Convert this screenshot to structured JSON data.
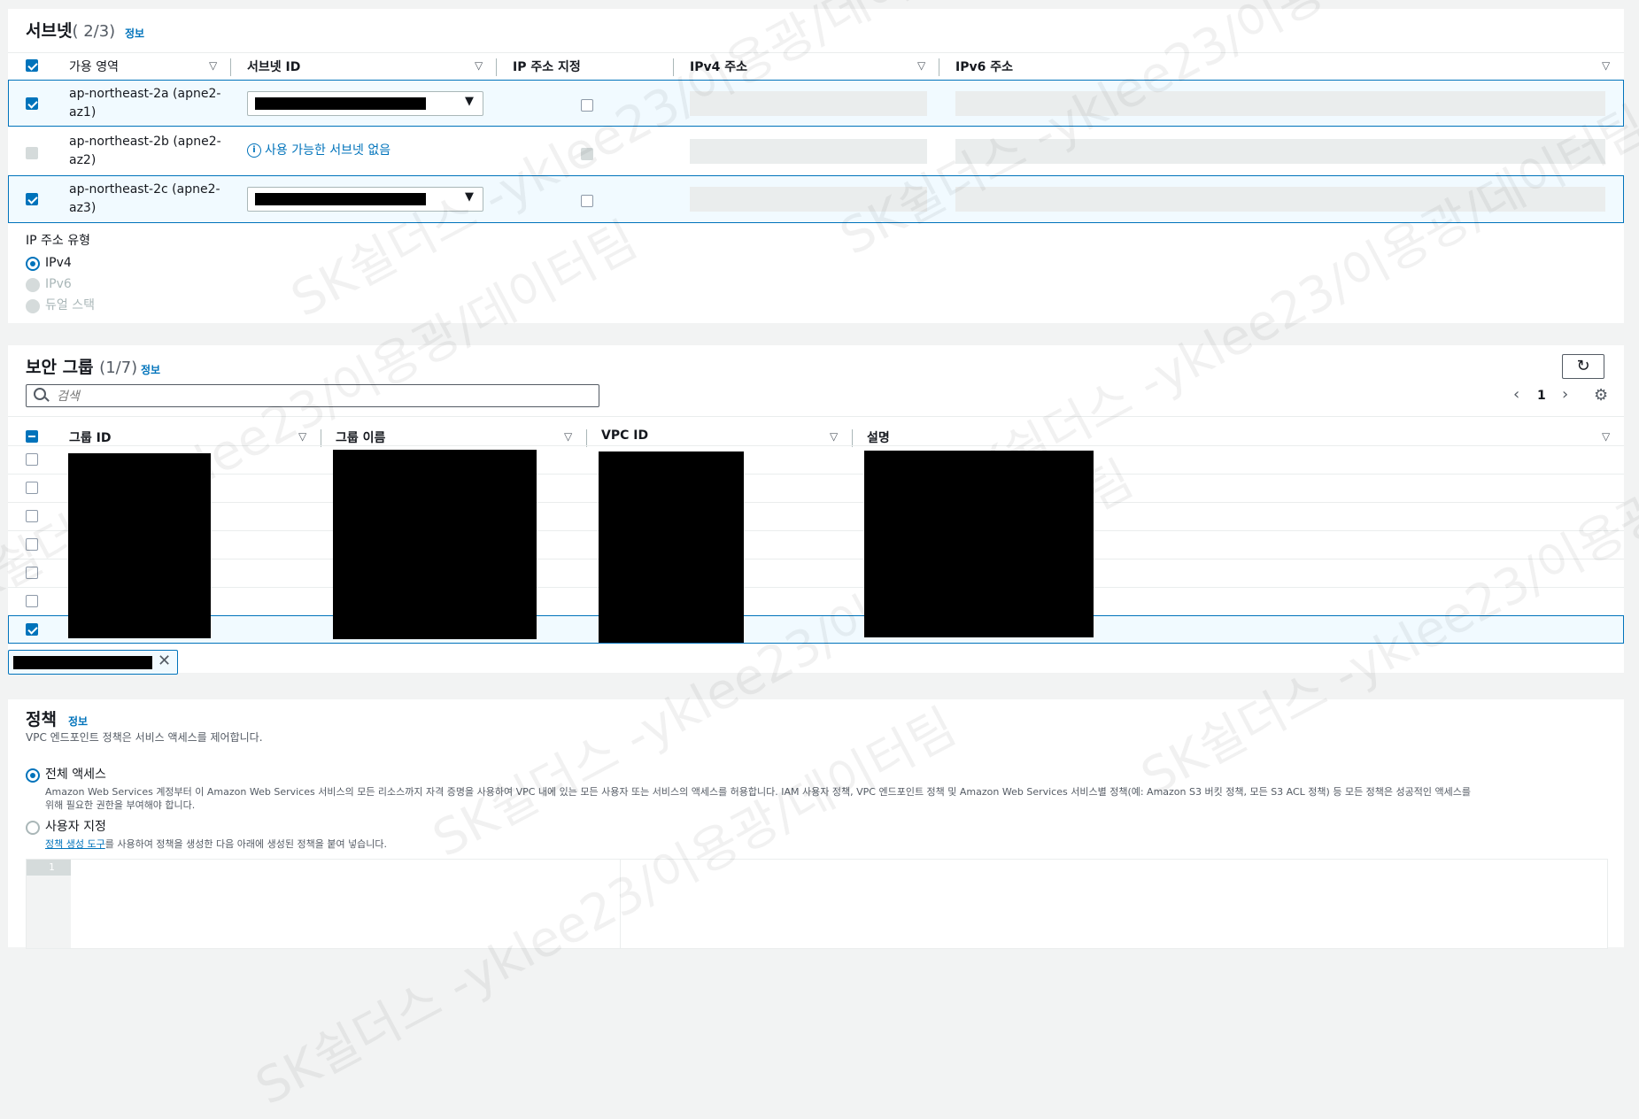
{
  "subnets": {
    "title": "서브넷",
    "count": "( 2/3)",
    "info": "정보",
    "columns": [
      "가용 영역",
      "서브넷 ID",
      "IP 주소 지정",
      "IPv4 주소",
      "IPv6 주소"
    ],
    "rows": [
      {
        "az_line1": "ap-northeast-2a (apne2-",
        "az_line2": "az1)",
        "checked": true
      },
      {
        "az_line1": "ap-northeast-2b (apne2-",
        "az_line2": "az2)",
        "checked": false,
        "notice": "사용 가능한 서브넷 없음"
      },
      {
        "az_line1": "ap-northeast-2c (apne2-",
        "az_line2": "az3)",
        "checked": true
      }
    ],
    "ip_type_label": "IP 주소 유형",
    "ip_types": [
      "IPv4",
      "IPv6",
      "듀얼 스택"
    ],
    "ip_type_selected": "IPv4"
  },
  "security_groups": {
    "title": "보안 그룹",
    "count": "(1/7)",
    "info": "정보",
    "search_placeholder": "검색",
    "page": "1",
    "columns": [
      "그룹 ID",
      "그룹 이름",
      "VPC ID",
      "설명"
    ],
    "row_count": 7,
    "selected_row": 7
  },
  "policy": {
    "title": "정책",
    "info": "정보",
    "subtitle": "VPC 엔드포인트 정책은 서비스 액세스를 제어합니다.",
    "full_access_label": "전체 액세스",
    "full_access_desc_1": "Amazon Web Services 계정부터 이 Amazon Web Services 서비스의 모든 리소스까지 자격 증명을 사용하여 VPC 내에 있는 모든 사용자 또는 서비스의 액세스를 허용합니다. IAM 사용자 정책, VPC 엔드포인트 정책 및 Amazon Web Services 서비스별 정책(예: Amazon S3 버킷 정책, 모든 S3 ACL 정책) 등 모든 정책은 성공적인 액세스를",
    "full_access_desc_2": "위해 필요한 권한을 부여해야 합니다.",
    "custom_label": "사용자 지정",
    "custom_link": "정책 생성 도구",
    "custom_desc": "를 사용하여 정책을 생성한 다음 아래에 생성된 정책을 붙여 넣습니다.",
    "editor_line": "1"
  },
  "watermark": "SK쉴더스 -yklee23/이용광/데이터팀"
}
